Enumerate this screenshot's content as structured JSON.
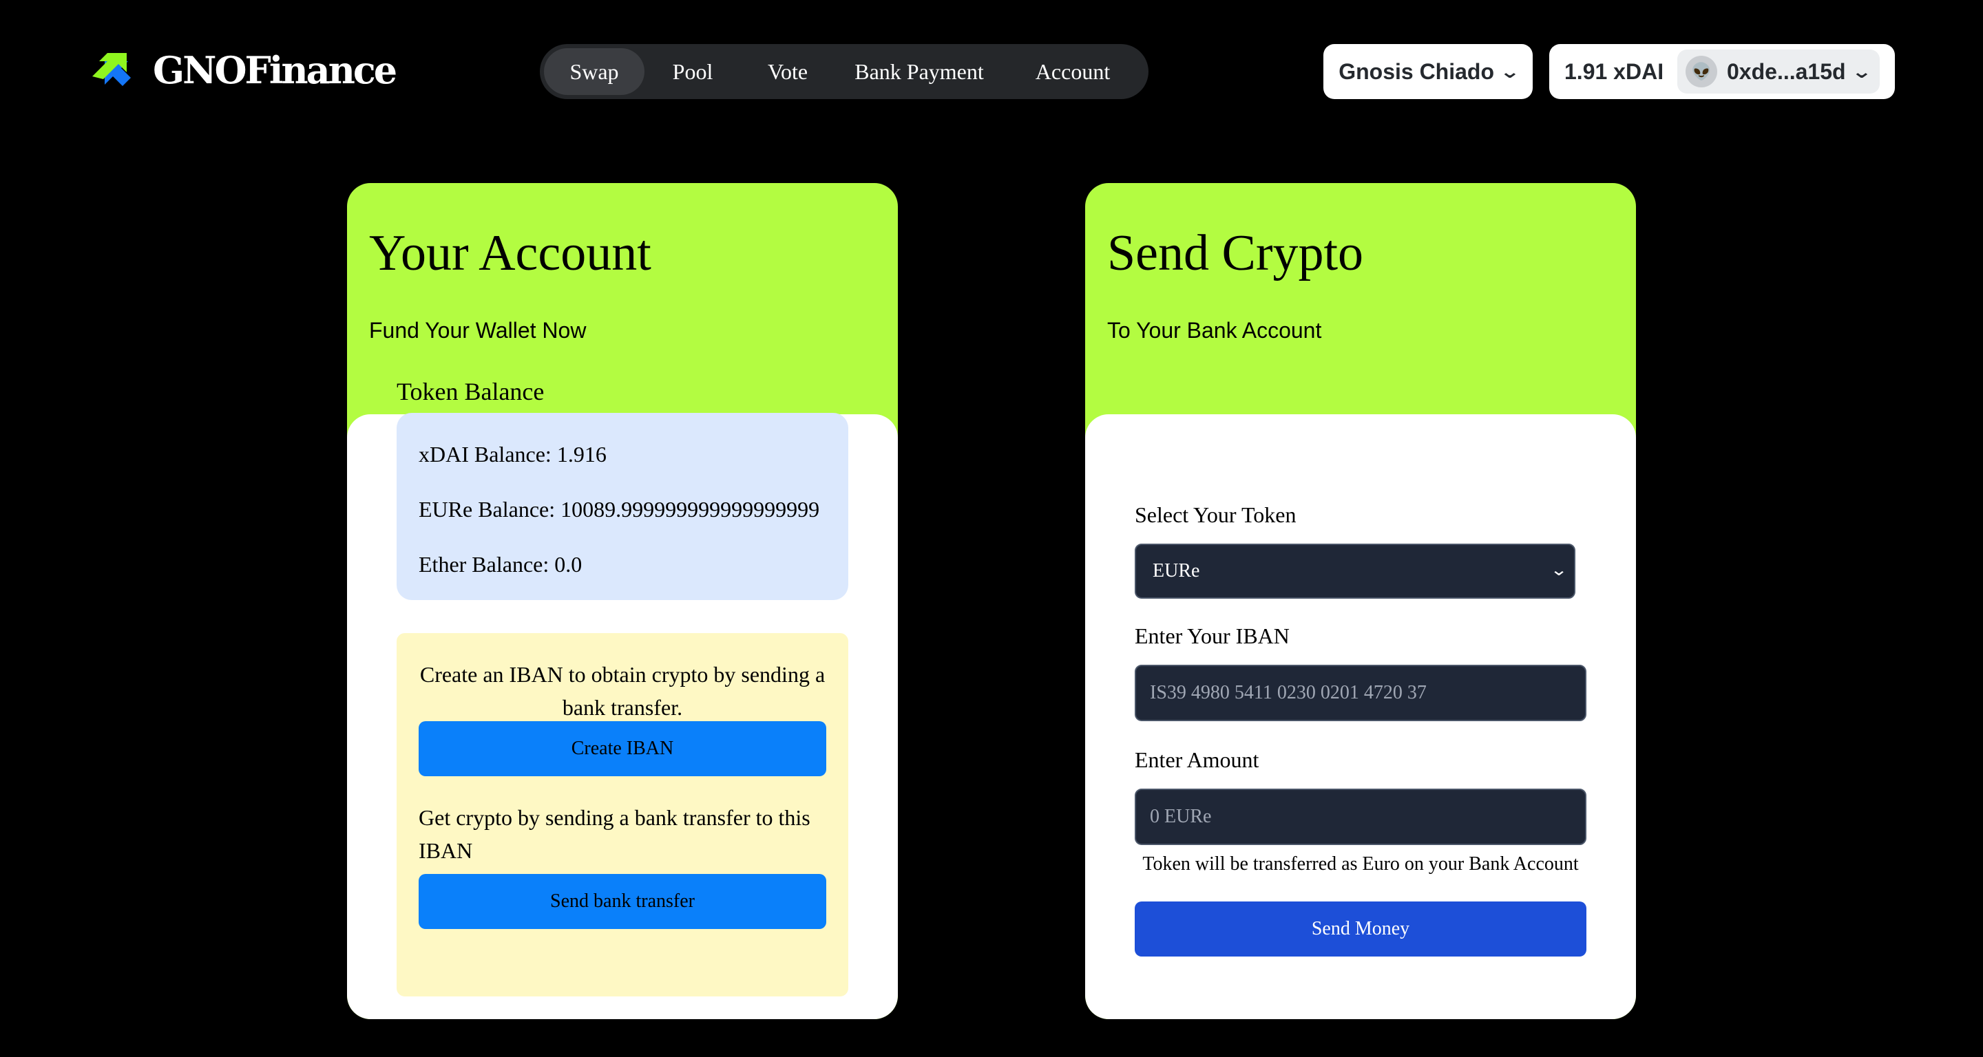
{
  "header": {
    "logo_text": "GNOFinance",
    "nav": [
      {
        "label": "Swap",
        "active": true
      },
      {
        "label": "Pool"
      },
      {
        "label": "Vote"
      },
      {
        "label": "Bank Payment"
      },
      {
        "label": "Account"
      }
    ],
    "chain_label": "Gnosis Chiado",
    "wallet_balance": "1.91 xDAI",
    "wallet_address": "0xde...a15d",
    "avatar_emoji": "👽"
  },
  "account_card": {
    "title": "Your Account",
    "subtitle": "Fund Your Wallet Now",
    "token_balance_label": "Token Balance",
    "balances": [
      "xDAI Balance: 1.916",
      "EURe Balance: 10089.999999999999999999",
      "Ether Balance: 0.0"
    ],
    "iban_text": "Create an IBAN to obtain crypto by sending a bank transfer.",
    "create_iban_button": "Create IBAN",
    "transfer_text": "Get crypto by sending a bank transfer to this IBAN",
    "send_bank_transfer_button": "Send bank transfer"
  },
  "send_card": {
    "title": "Send Crypto",
    "subtitle": "To Your Bank Account",
    "select_token_label": "Select Your Token",
    "selected_token": "EURe",
    "iban_label": "Enter Your IBAN",
    "iban_placeholder": "IS39 4980 5411 0230 0201 4720 37",
    "amount_label": "Enter Amount",
    "amount_placeholder": "0 EURe",
    "note": "Token will be transferred as Euro on your Bank Account",
    "send_button": "Send Money"
  },
  "colors": {
    "accent_green": "#b3fc41",
    "primary_blue": "#0a80fa",
    "send_blue": "#1d4fd8",
    "balance_bg": "#dbe8fd",
    "iban_bg": "#fef8c4",
    "input_bg": "#1f2737"
  }
}
